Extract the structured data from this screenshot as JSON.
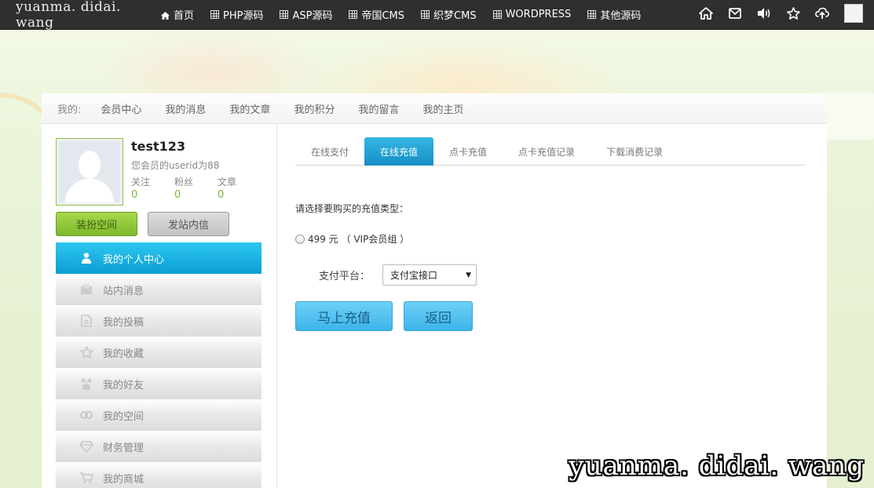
{
  "brand": "yuanma. didai. wang",
  "topnav": [
    {
      "label": "首页",
      "icon": "home-icon"
    },
    {
      "label": "PHP源码",
      "icon": "grid-icon"
    },
    {
      "label": "ASP源码",
      "icon": "grid-icon"
    },
    {
      "label": "帝国CMS",
      "icon": "grid-icon"
    },
    {
      "label": "织梦CMS",
      "icon": "grid-icon"
    },
    {
      "label": "WORDPRESS",
      "icon": "grid-icon"
    },
    {
      "label": "其他源码",
      "icon": "grid-icon"
    }
  ],
  "topright_icons": [
    "home-icon",
    "mail-icon",
    "volume-icon",
    "star-icon",
    "upload-icon"
  ],
  "subnav": {
    "label": "我的:",
    "links": [
      "会员中心",
      "我的消息",
      "我的文章",
      "我的积分",
      "我的留言",
      "我的主页"
    ]
  },
  "profile": {
    "username": "test123",
    "userid_text": "您会员的userid为88",
    "stats": [
      {
        "label": "关注",
        "value": "0"
      },
      {
        "label": "粉丝",
        "value": "0"
      },
      {
        "label": "文章",
        "value": "0"
      }
    ],
    "btn_decorate": "装扮空间",
    "btn_message": "发站内信"
  },
  "menu": [
    {
      "label": "我的个人中心",
      "icon": "user-icon",
      "active": true
    },
    {
      "label": "站内消息",
      "icon": "message-icon",
      "active": false
    },
    {
      "label": "我的投稿",
      "icon": "document-icon",
      "active": false
    },
    {
      "label": "我的收藏",
      "icon": "star-icon",
      "active": false
    },
    {
      "label": "我的好友",
      "icon": "friends-icon",
      "active": false
    },
    {
      "label": "我的空间",
      "icon": "space-icon",
      "active": false
    },
    {
      "label": "财务管理",
      "icon": "diamond-icon",
      "active": false
    },
    {
      "label": "我的商城",
      "icon": "cart-icon",
      "active": false
    }
  ],
  "tabs": [
    {
      "label": "在线支付",
      "active": false
    },
    {
      "label": "在线充值",
      "active": true
    },
    {
      "label": "点卡充值",
      "active": false
    },
    {
      "label": "点卡充值记录",
      "active": false
    },
    {
      "label": "下载消费记录",
      "active": false
    }
  ],
  "form": {
    "prompt": "请选择要购买的充值类型：",
    "option_label": "499 元 （ VIP会员组 ）",
    "pay_label": "支付平台：",
    "pay_selected": "支付宝接口",
    "btn_charge": "马上充值",
    "btn_back": "返回"
  },
  "watermark": "yuanma. didai. wang"
}
